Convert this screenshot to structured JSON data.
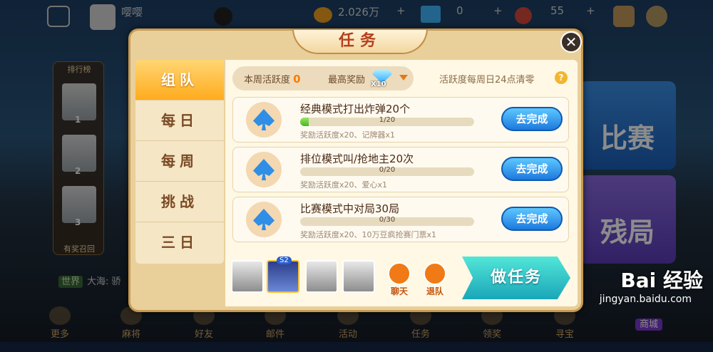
{
  "topbar": {
    "username": "嘤嘤",
    "coins": "2.026万",
    "diamonds": "0",
    "tickets": "55",
    "plus": "+"
  },
  "leaderboard": {
    "title": "排行榜",
    "ranks": [
      "1",
      "2",
      "3"
    ],
    "footer": "有奖召回"
  },
  "chat": {
    "tag": "世界",
    "text": "大海: 骄"
  },
  "right_buttons": {
    "match": "比赛",
    "endgame": "残局"
  },
  "bottom_nav": [
    "更多",
    "麻将",
    "好友",
    "邮件",
    "活动",
    "任务",
    "领奖",
    "寻宝",
    "商城"
  ],
  "watermark": {
    "brand": "Bai 经验",
    "url": "jingyan.baidu.com"
  },
  "modal": {
    "title": "任务",
    "close": "✕",
    "tabs": [
      "组队",
      "每日",
      "每周",
      "挑战",
      "三日"
    ],
    "active_tab": 0,
    "stats": {
      "weekly_label": "本周活跃度",
      "weekly_value": "0",
      "max_reward_label": "最高奖励",
      "max_reward_mult": "X10",
      "reset_note": "活跃度每周日24点清零",
      "help": "?"
    },
    "tasks": [
      {
        "title": "经典模式打出炸弹20个",
        "progress": "1/20",
        "progress_fraction": 0.05,
        "reward": "奖励活跃度x20、记牌器x1",
        "button": "去完成"
      },
      {
        "title": "排位模式叫/抢地主20次",
        "progress": "0/20",
        "progress_fraction": 0.0,
        "reward": "奖励活跃度x20、爱心x1",
        "button": "去完成"
      },
      {
        "title": "比赛模式中对局30局",
        "progress": "0/30",
        "progress_fraction": 0.0,
        "reward": "奖励活跃度x20、10万豆疯抢赛门票x1",
        "button": "去完成"
      }
    ],
    "team": {
      "badge": "S2",
      "chat_label": "聊天",
      "leave_label": "退队",
      "do_task": "做任务"
    }
  },
  "colors": {
    "accent_orange": "#ffab1e",
    "button_blue": "#1d79de",
    "progress_green": "#43b82a",
    "do_task_cyan": "#1aa6b8"
  }
}
